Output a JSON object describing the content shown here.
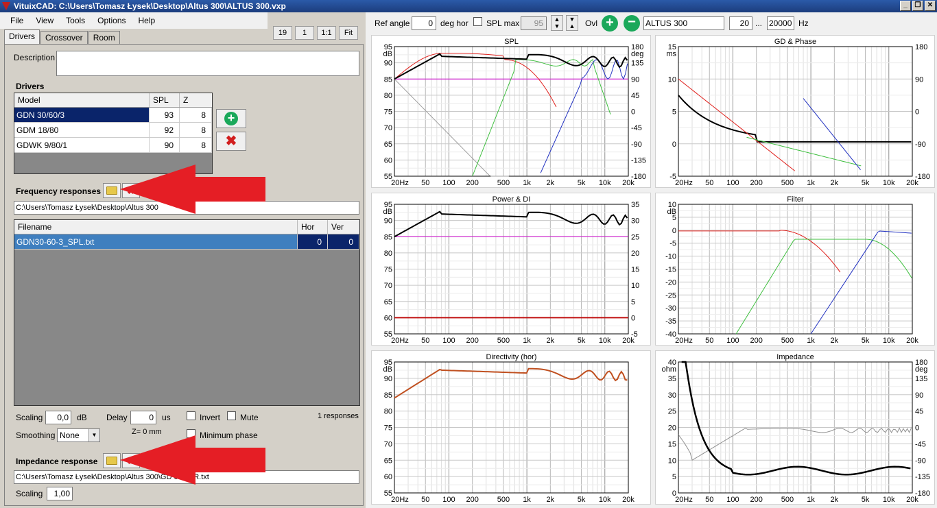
{
  "window": {
    "title": "VituixCAD: C:\\Users\\Tomasz Łysek\\Desktop\\Altus 300\\ALTUS 300.vxp",
    "minimize": "_",
    "restore": "❐",
    "close": "✕"
  },
  "menu": [
    "File",
    "View",
    "Tools",
    "Options",
    "Help"
  ],
  "tabs": [
    "Drivers",
    "Crossover",
    "Room"
  ],
  "top_buttons": {
    "b1": "19",
    "b2": "1",
    "b3": "1:1",
    "b4": "Fit"
  },
  "description": {
    "label": "Description",
    "value": ""
  },
  "drivers": {
    "title": "Drivers",
    "columns": [
      "Model",
      "SPL",
      "Z"
    ],
    "rows": [
      {
        "model": "GDN 30/60/3",
        "spl": "93",
        "z": "8"
      },
      {
        "model": "GDM 18/80",
        "spl": "92",
        "z": "8"
      },
      {
        "model": "GDWK 9/80/1",
        "spl": "90",
        "z": "8"
      }
    ]
  },
  "freq": {
    "title": "Frequency responses",
    "path": "C:\\Users\\Tomasz Łysek\\Desktop\\Altus 300",
    "columns": [
      "Filename",
      "Hor",
      "Ver"
    ],
    "rows": [
      {
        "filename": "GDN30-60-3_SPL.txt",
        "hor": "0",
        "ver": "0"
      }
    ]
  },
  "controls": {
    "scaling_label": "Scaling",
    "scaling_value": "0,0",
    "scaling_unit": "dB",
    "delay_label": "Delay",
    "delay_value": "0",
    "delay_unit": "us",
    "invert": "Invert",
    "mute": "Mute",
    "responses": "1 responses",
    "smoothing_label": "Smoothing",
    "smoothing_value": "None",
    "z0": "Z= 0 mm",
    "min_phase": "Minimum phase"
  },
  "impedance": {
    "title": "Impedance response",
    "path": "C:\\Users\\Tomasz Łysek\\Desktop\\Altus 300\\GDN30-60-3_ZR.txt",
    "path_visible": "C:\\Users\\Tomasz Łysek\\Desktop\\Altus 300\\GD        0-3_ZR.txt",
    "scaling_label": "Scaling",
    "scaling_value": "1,00"
  },
  "toolbar": {
    "ref_angle_label": "Ref angle",
    "ref_angle_value": "0",
    "deg_hor": "deg hor",
    "spl_max_label": "SPL max",
    "spl_max_value": "95",
    "ovl": "Ovl",
    "name_value": "ALTUS 300",
    "fmin": "20",
    "dots": "...",
    "fmax": "20000",
    "hz": "Hz"
  },
  "colors": {
    "accent": "#0a246a",
    "red": "#e0201c",
    "green": "#3fbf3f",
    "blue": "#2030c0",
    "magenta": "#d000d0"
  },
  "chart_data": [
    {
      "type": "line",
      "title": "SPL",
      "ylabel": "dB",
      "y2label": "deg",
      "x_ticks": [
        "20Hz",
        "50",
        "100",
        "200",
        "500",
        "1k",
        "2k",
        "5k",
        "10k",
        "20k"
      ],
      "y_ticks": [
        "95",
        "90",
        "85",
        "80",
        "75",
        "70",
        "65",
        "60",
        "55"
      ],
      "y2_ticks": [
        "180",
        "135",
        "90",
        "45",
        "0",
        "-45",
        "-90",
        "-135",
        "-180"
      ],
      "ylim": [
        55,
        95
      ],
      "y2lim": [
        -180,
        180
      ]
    },
    {
      "type": "line",
      "title": "GD & Phase",
      "ylabel": "ms",
      "x_ticks": [
        "20Hz",
        "50",
        "100",
        "200",
        "500",
        "1k",
        "2k",
        "5k",
        "10k",
        "20k"
      ],
      "y_ticks": [
        "15",
        "10",
        "5",
        "0",
        "-5"
      ],
      "y2_ticks": [
        "180",
        "90",
        "0",
        "-90",
        "-180"
      ],
      "ylim": [
        -5,
        15
      ],
      "y2lim": [
        -180,
        180
      ]
    },
    {
      "type": "line",
      "title": "Power & DI",
      "ylabel": "dB",
      "x_ticks": [
        "20Hz",
        "50",
        "100",
        "200",
        "500",
        "1k",
        "2k",
        "5k",
        "10k",
        "20k"
      ],
      "y_ticks": [
        "95",
        "90",
        "85",
        "80",
        "75",
        "70",
        "65",
        "60",
        "55"
      ],
      "y2_ticks": [
        "35",
        "30",
        "25",
        "20",
        "15",
        "10",
        "5",
        "0",
        "-5"
      ],
      "ylim": [
        55,
        95
      ],
      "y2lim": [
        -5,
        35
      ]
    },
    {
      "type": "line",
      "title": "Filter",
      "ylabel": "dB",
      "x_ticks": [
        "20Hz",
        "50",
        "100",
        "200",
        "500",
        "1k",
        "2k",
        "5k",
        "10k",
        "20k"
      ],
      "y_ticks": [
        "10",
        "5",
        "0",
        "-5",
        "-10",
        "-15",
        "-20",
        "-25",
        "-30",
        "-35",
        "-40"
      ],
      "ylim": [
        -40,
        10
      ]
    },
    {
      "type": "line",
      "title": "Directivity (hor)",
      "ylabel": "dB",
      "x_ticks": [
        "20Hz",
        "50",
        "100",
        "200",
        "500",
        "1k",
        "2k",
        "5k",
        "10k",
        "20k"
      ],
      "y_ticks": [
        "95",
        "90",
        "85",
        "80",
        "75",
        "70",
        "65",
        "60",
        "55"
      ],
      "ylim": [
        55,
        95
      ]
    },
    {
      "type": "line",
      "title": "Impedance",
      "ylabel": "ohm",
      "y2label": "deg",
      "x_ticks": [
        "20Hz",
        "50",
        "100",
        "200",
        "500",
        "1k",
        "2k",
        "5k",
        "10k",
        "20k"
      ],
      "y_ticks": [
        "40",
        "35",
        "30",
        "25",
        "20",
        "15",
        "10",
        "5",
        "0"
      ],
      "y2_ticks": [
        "180",
        "135",
        "90",
        "45",
        "0",
        "-45",
        "-90",
        "-135",
        "-180"
      ],
      "ylim": [
        0,
        40
      ],
      "y2lim": [
        -180,
        180
      ]
    }
  ]
}
